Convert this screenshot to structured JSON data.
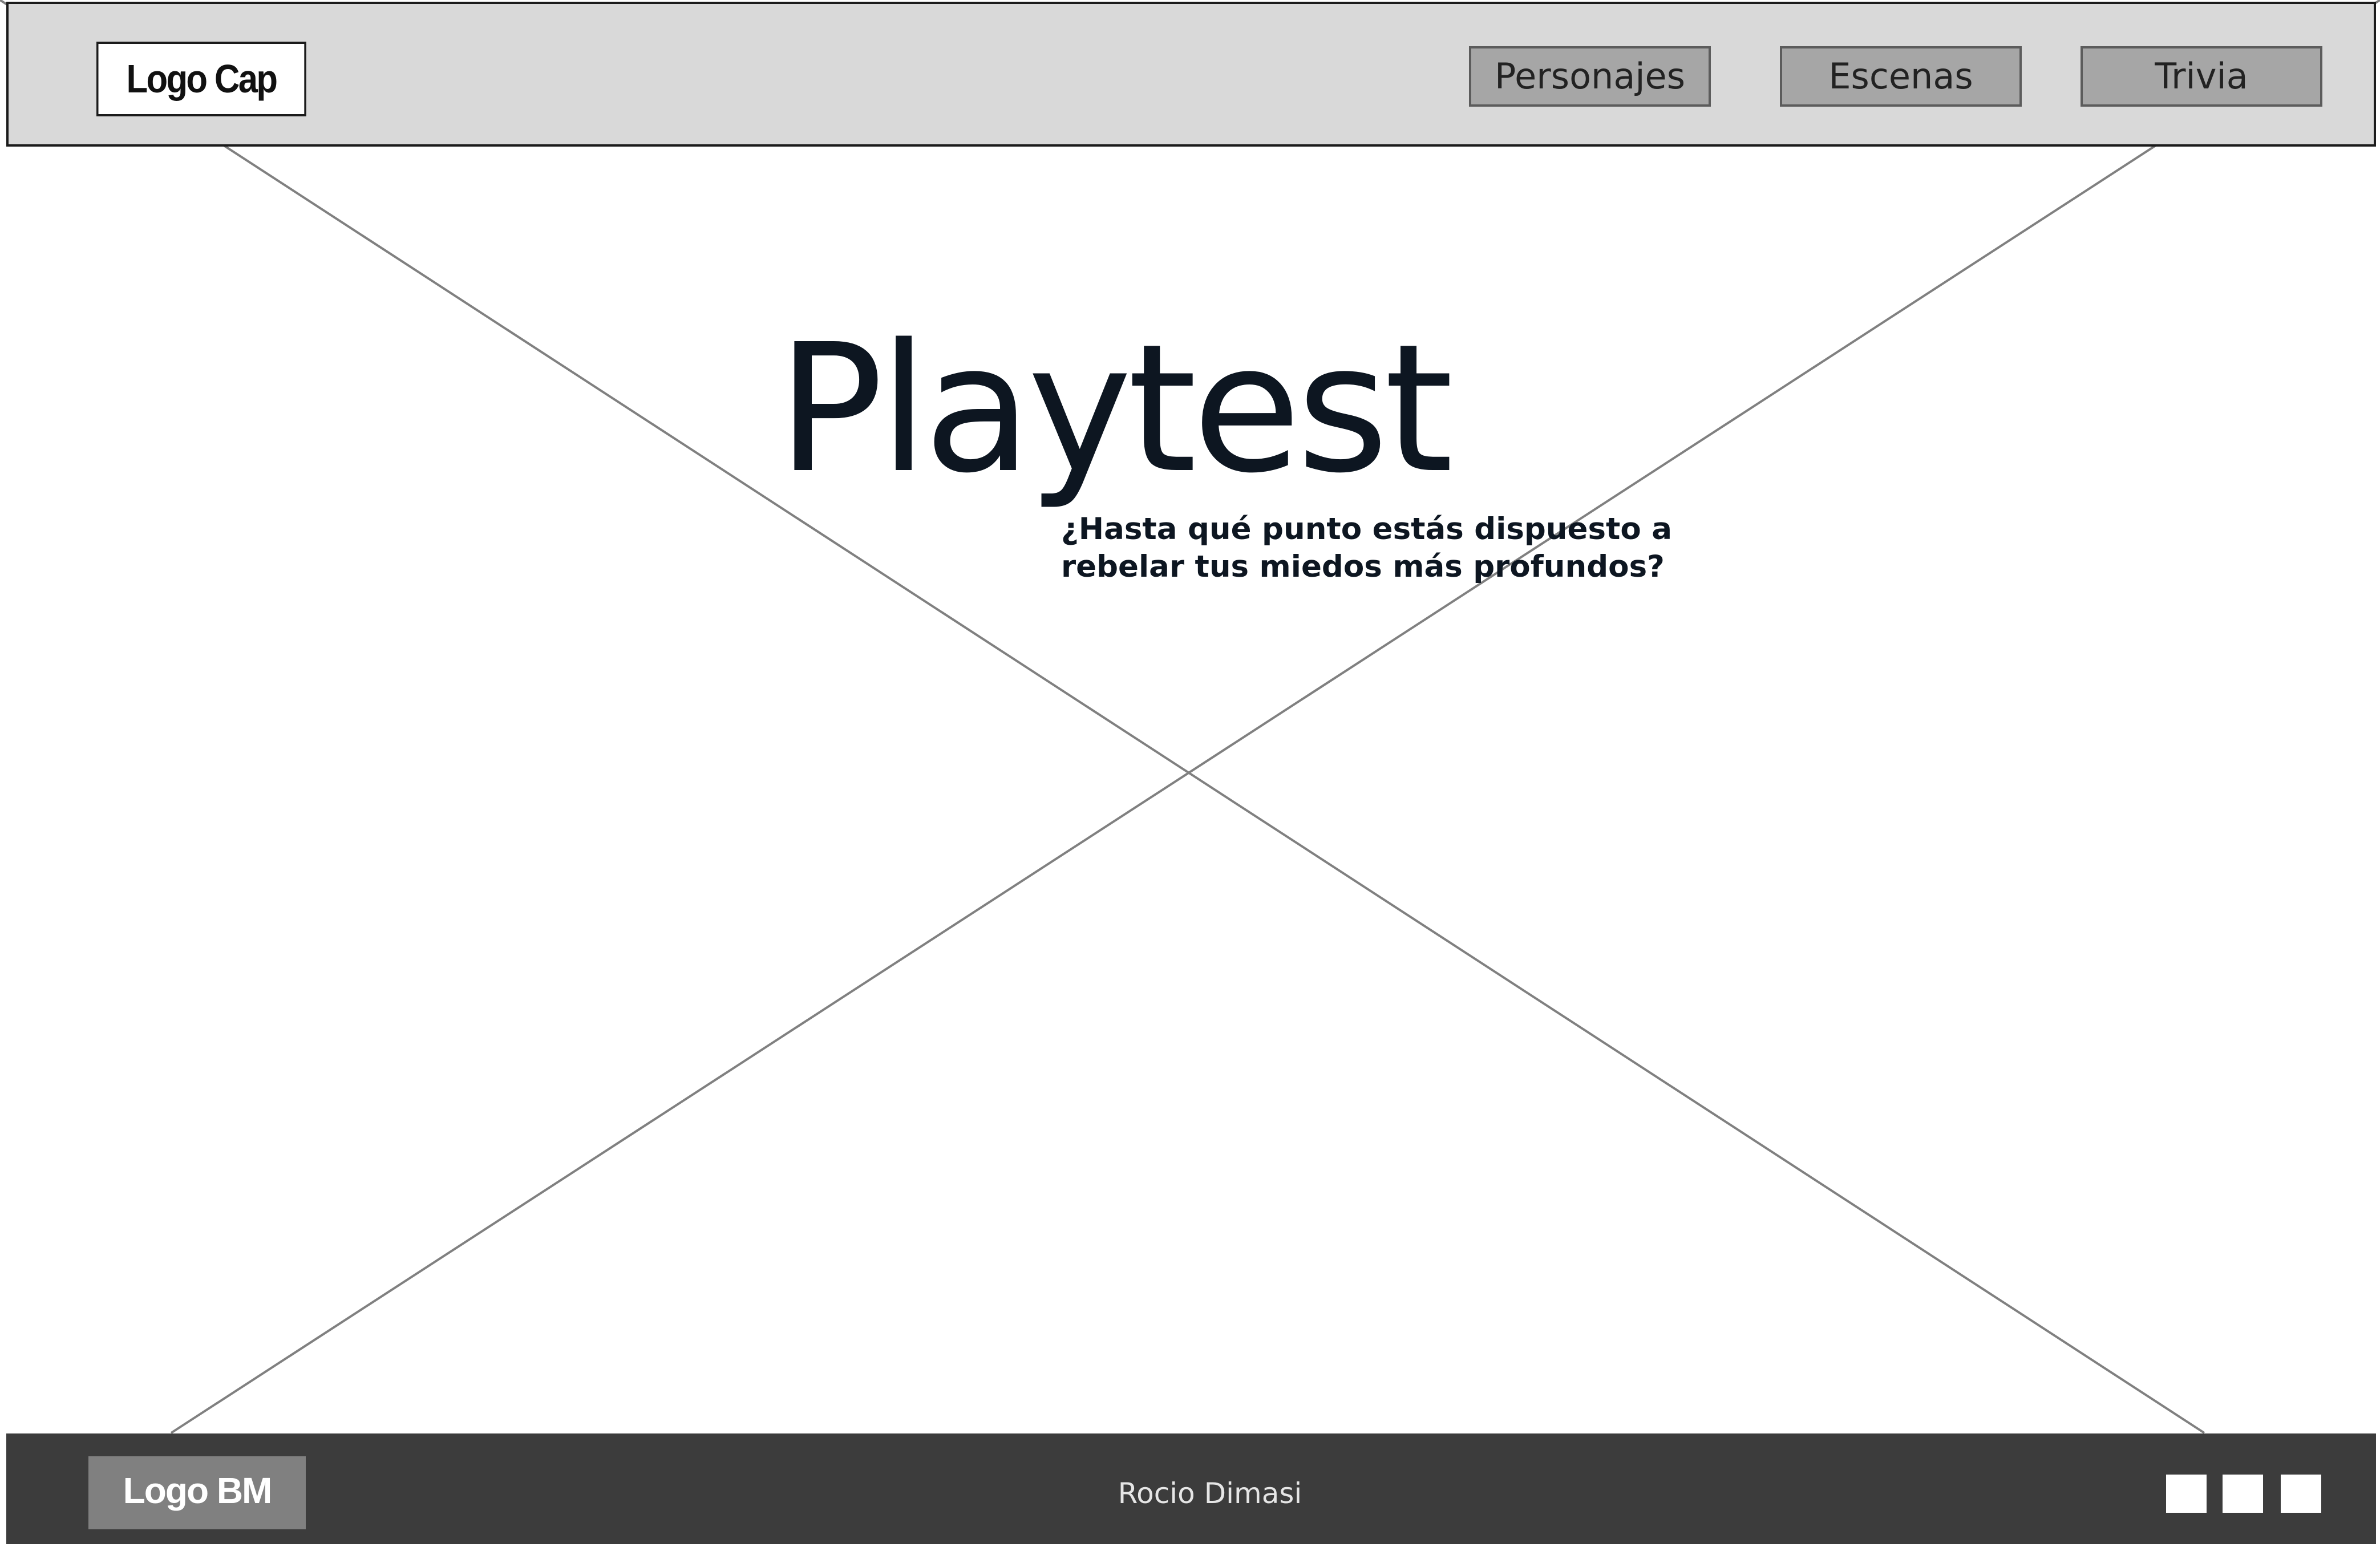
{
  "header": {
    "logo": "Logo Cap",
    "nav": [
      {
        "label": "Personajes"
      },
      {
        "label": "Escenas"
      },
      {
        "label": "Trivia"
      }
    ]
  },
  "hero": {
    "title": "Playtest",
    "subtitle_line1": "¿Hasta qué punto estás dispuesto a",
    "subtitle_line2": "rebelar tus miedos más profundos?"
  },
  "footer": {
    "logo": "Logo BM",
    "credit": "Rocio Dimasi",
    "social_icons": [
      "social-icon-1",
      "social-icon-2",
      "social-icon-3"
    ]
  },
  "colors": {
    "header_bg": "#d9d9d9",
    "nav_button_bg": "#a6a6a6",
    "footer_bg": "#3c3c3c",
    "footer_logo_bg": "#808080",
    "title_text": "#0d1621"
  }
}
